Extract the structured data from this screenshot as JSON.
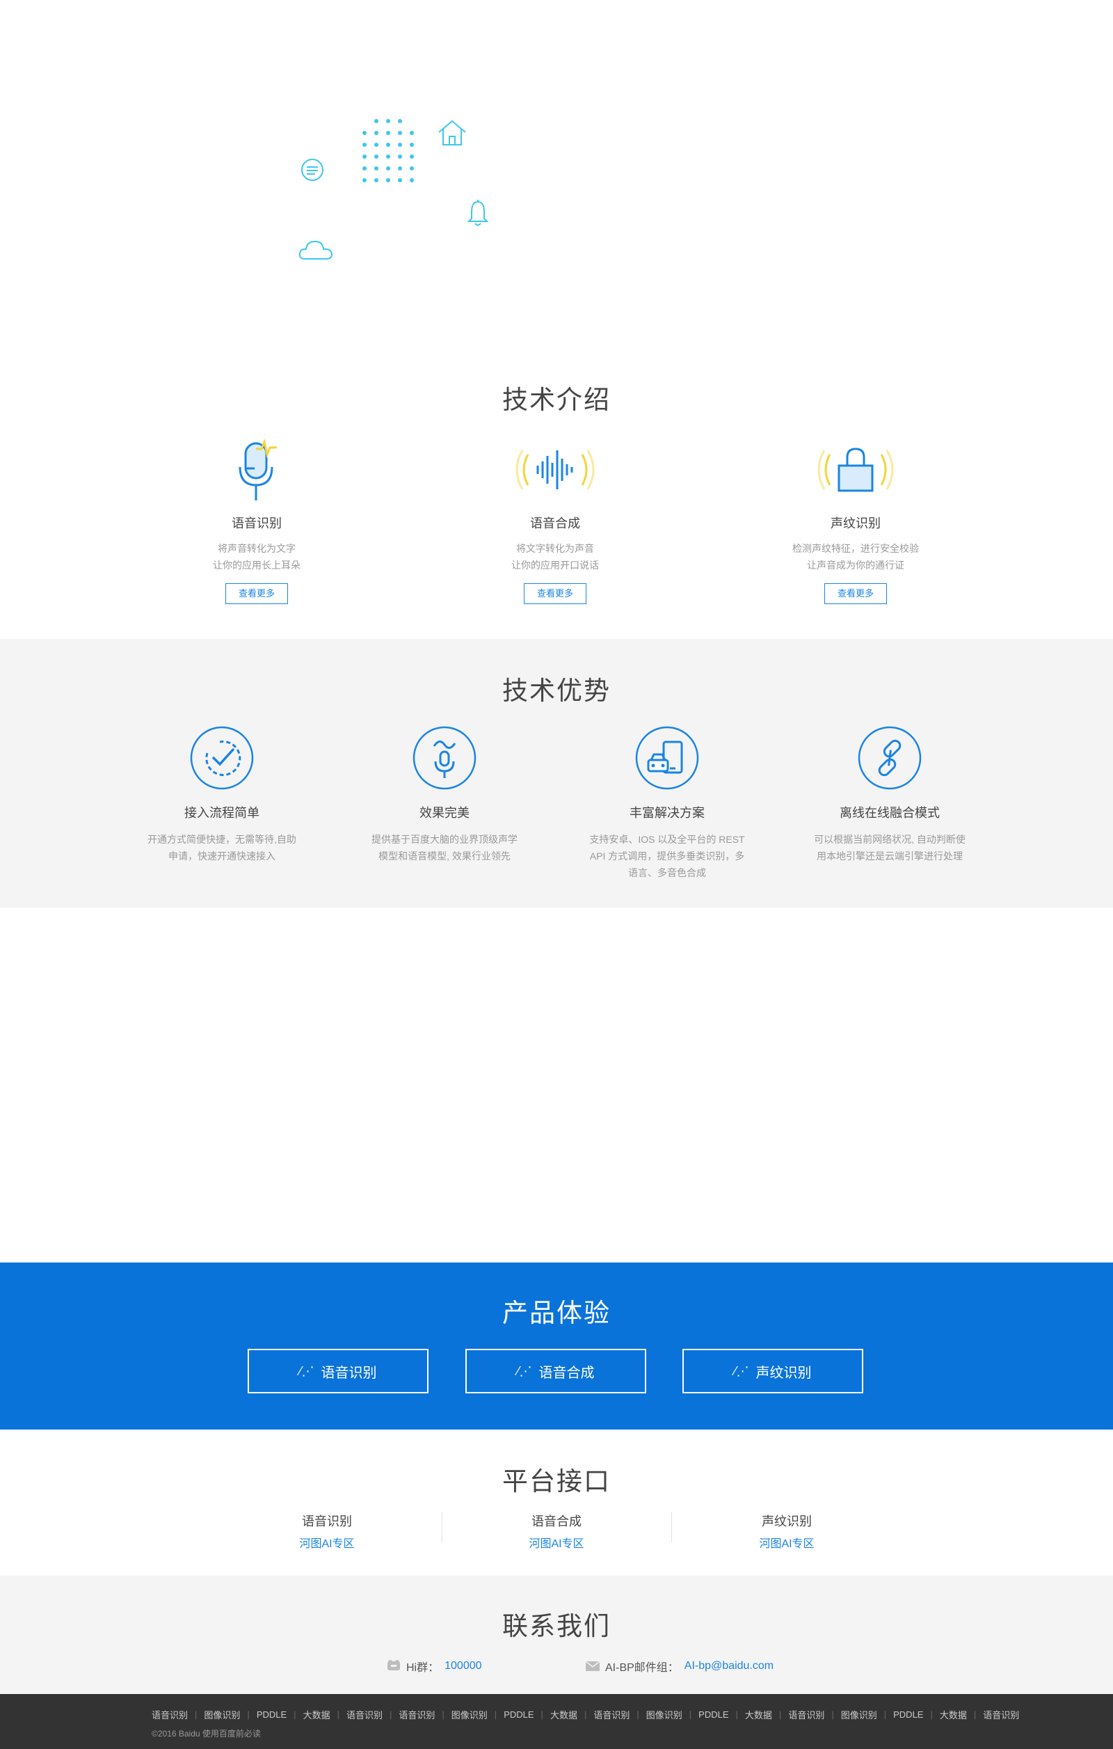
{
  "colors": {
    "accent": "#1a84e4",
    "product_bg": "#0a73d9",
    "cyan": "#3cc7ef",
    "yellow": "#f5d33a",
    "footer_bg": "#333333",
    "gray_bg": "#f4f4f4"
  },
  "hero": {
    "icons": [
      "chat-icon",
      "dot-grid-icon",
      "house-icon",
      "bell-icon",
      "cloud-icon"
    ]
  },
  "intro": {
    "title": "技术介绍",
    "cards": [
      {
        "title": "语音识别",
        "desc1": "将声音转化为文字",
        "desc2": "让你的应用长上耳朵",
        "button": "查看更多",
        "icon": "microphone-icon"
      },
      {
        "title": "语音合成",
        "desc1": "将文字转化为声音",
        "desc2": "让你的应用开口说话",
        "button": "查看更多",
        "icon": "soundwave-icon"
      },
      {
        "title": "声纹识别",
        "desc1": "检测声纹特征，进行安全校验",
        "desc2": "让声音成为你的通行证",
        "button": "查看更多",
        "icon": "lock-icon"
      }
    ]
  },
  "advantages": {
    "title": "技术优势",
    "cards": [
      {
        "title": "接入流程简单",
        "desc": [
          "开通方式简便快捷，无需等待,自助",
          "申请，快速开通快速接入"
        ],
        "icon": "check-circle-icon"
      },
      {
        "title": "效果完美",
        "desc": [
          "提供基于百度大脑的业界顶级声学",
          "模型和语音模型, 效果行业领先"
        ],
        "icon": "mic-circle-icon"
      },
      {
        "title": "丰富解决方案",
        "desc": [
          "支持安卓、IOS 以及全平台的 REST",
          "API 方式调用，提供多垂类识别，多",
          "语言、多音色合成"
        ],
        "icon": "device-circle-icon"
      },
      {
        "title": "离线在线融合模式",
        "desc": [
          "可以根据当前网络状况, 自动判断使",
          "用本地引擎还是云端引擎进行处理"
        ],
        "icon": "link-circle-icon"
      }
    ]
  },
  "product": {
    "title": "产品体验",
    "buttons": [
      {
        "label": "语音识别",
        "icon": "magic-wand-icon"
      },
      {
        "label": "语音合成",
        "icon": "magic-wand-icon"
      },
      {
        "label": "声纹识别",
        "icon": "magic-wand-icon"
      }
    ]
  },
  "platform": {
    "title": "平台接口",
    "items": [
      {
        "name": "语音识别",
        "link": "河图AI专区"
      },
      {
        "name": "语音合成",
        "link": "河图AI专区"
      },
      {
        "name": "声纹识别",
        "link": "河图AI专区"
      }
    ]
  },
  "contact": {
    "title": "联系我们",
    "hi_label": "Hi群：",
    "hi_value": "100000",
    "mail_label": "AI-BP邮件组：",
    "mail_value": "AI-bp@baidu.com"
  },
  "footer": {
    "links": [
      "语音识别",
      "图像识别",
      "PDDLE",
      "大数据",
      "语音识别",
      "语音识别",
      "图像识别",
      "PDDLE",
      "大数据",
      "语音识别",
      "图像识别",
      "PDDLE",
      "大数据",
      "语音识别",
      "图像识别",
      "PDDLE",
      "大数据",
      "语音识别"
    ],
    "copyright": "©2016 Baidu 使用百度前必读"
  }
}
